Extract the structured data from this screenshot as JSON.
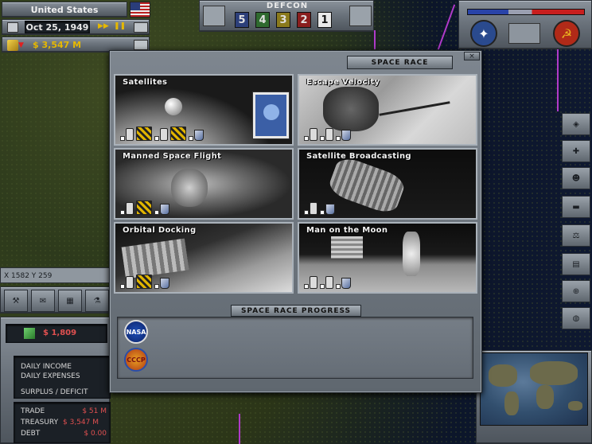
{
  "hud": {
    "country": "United States",
    "date": "Oct 25, 1949",
    "treasury_top": "$ 3,547 M",
    "coords": "X 1582 Y 259",
    "defcon_label": "DEFCON",
    "defcon_levels": [
      "5",
      "4",
      "3",
      "2",
      "1"
    ],
    "defcon_colors": [
      "#2c3f7a",
      "#2f6a2f",
      "#8a7a1c",
      "#8a1e1e",
      "#e8e8e8"
    ]
  },
  "budget": {
    "funds": "$ 1,809",
    "daily_income": "DAILY INCOME",
    "daily_expenses": "DAILY EXPENSES",
    "surplus": "SURPLUS / DEFICIT",
    "trade_label": "TRADE",
    "trade_value": "$ 51 M",
    "treasury_label": "TREASURY",
    "treasury_value": "$ 3,547 M",
    "debt_label": "DEBT",
    "debt_value": "$ 0.00"
  },
  "window": {
    "title": "SPACE RACE",
    "close": "×",
    "progress_title": "SPACE RACE PROGRESS"
  },
  "tiles": [
    {
      "title": "Satellites"
    },
    {
      "title": "Escape Velocity"
    },
    {
      "title": "Manned Space Flight"
    },
    {
      "title": "Satellite Broadcasting"
    },
    {
      "title": "Orbital Docking"
    },
    {
      "title": "Man on the Moon"
    }
  ],
  "logos": {
    "nasa": "NASA",
    "cccp": "CCCP"
  },
  "icons": {
    "flag": "us-flag-icon",
    "nato": "nato-emblem-icon",
    "warsaw": "warsaw-pact-emblem-icon"
  }
}
